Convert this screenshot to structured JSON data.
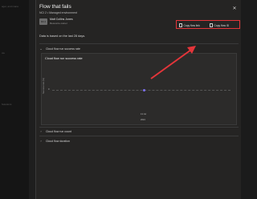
{
  "background_app": {
    "items": [
      "ager, and mana",
      "ow",
      "Solutions"
    ]
  },
  "panel": {
    "title": "Flow that fails",
    "subtitle": "NCI 2 • Managed environment",
    "close_symbol": "✕",
    "owner": {
      "initials": "MCJ",
      "name": "Matt Collins Jones",
      "role": "Resource owner"
    },
    "copy_link_label": "Copy flow link",
    "copy_id_label": "Copy flow ID",
    "info_text": "Data is based on the last 28 days.",
    "sections": {
      "success_rate": "Cloud flow run success rate",
      "run_count": "Cloud flow run count",
      "duration": "Cloud flow duration"
    },
    "chart_card": {
      "title": "Cloud flow run success rate"
    }
  },
  "chart_data": {
    "type": "scatter",
    "ylabel": "Success rate (%)",
    "yticks": [
      "0"
    ],
    "xticks": [
      "13 Jul",
      "2024"
    ],
    "points": [
      {
        "x": "13 Jul 2024",
        "y": 0
      }
    ]
  },
  "annotation": {
    "arrow_color": "#e4353a"
  }
}
